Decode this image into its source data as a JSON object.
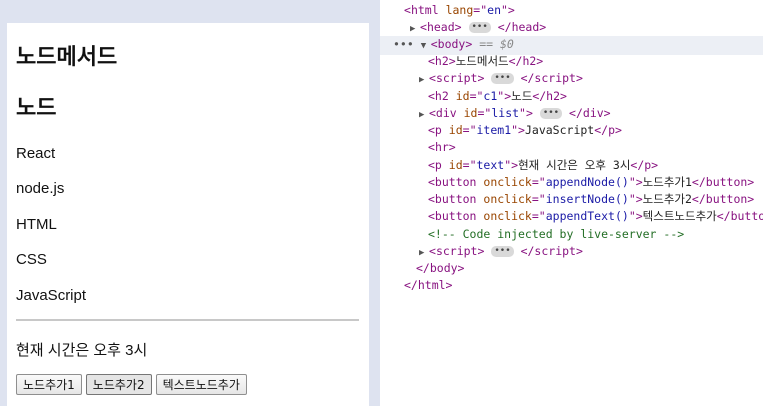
{
  "page": {
    "heading1": "노드메서드",
    "heading2": "노드",
    "list_items": [
      "React",
      "node.js",
      "HTML",
      "CSS"
    ],
    "item1": "JavaScript",
    "time_text": "현재 시간은 오후 3시",
    "buttons": [
      "노드추가1",
      "노드추가2",
      "텍스트노드추가"
    ]
  },
  "devtools": {
    "html_open": {
      "tag": "html",
      "attr": "lang",
      "value": "en"
    },
    "head": "head",
    "body_label": "body",
    "body_hint": "== $0",
    "h2_text": "노드메서드",
    "script": "script",
    "h2_id": "c1",
    "h2_id_text": "노드",
    "div_id": "list",
    "p_id": "item1",
    "p_id_text": "JavaScript",
    "hr": "hr",
    "p_text_id": "text",
    "p_text_text": "현재 시간은 오후 3시",
    "button1_onclick": "appendNode()",
    "button1_text": "노드추가1",
    "button2_onclick": "insertNode()",
    "button2_text": "노드추가2",
    "button3_onclick": "appendText()",
    "button3_text": "텍스트노드추가",
    "comment": "<!-- Code injected by live-server -->",
    "body_close": "</body>",
    "html_close": "</html>"
  }
}
